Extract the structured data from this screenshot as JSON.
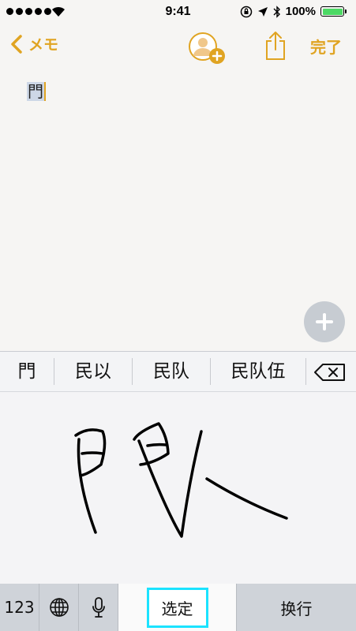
{
  "status_bar": {
    "time": "9:41",
    "battery_percent": "100%"
  },
  "nav": {
    "back_label": "メモ",
    "done_label": "完了"
  },
  "note": {
    "text": "門"
  },
  "candidates": [
    "門",
    "民以",
    "民队",
    "民队伍"
  ],
  "keys": {
    "numbers": "123",
    "select": "选定",
    "return": "换行"
  },
  "colors": {
    "accent": "#e0a422",
    "focus": "#1be3ff",
    "battery": "#4cd964"
  },
  "icons": [
    "chevron-left-icon",
    "add-person-icon",
    "share-icon",
    "plus-icon",
    "backspace-icon",
    "globe-icon",
    "microphone-icon"
  ]
}
